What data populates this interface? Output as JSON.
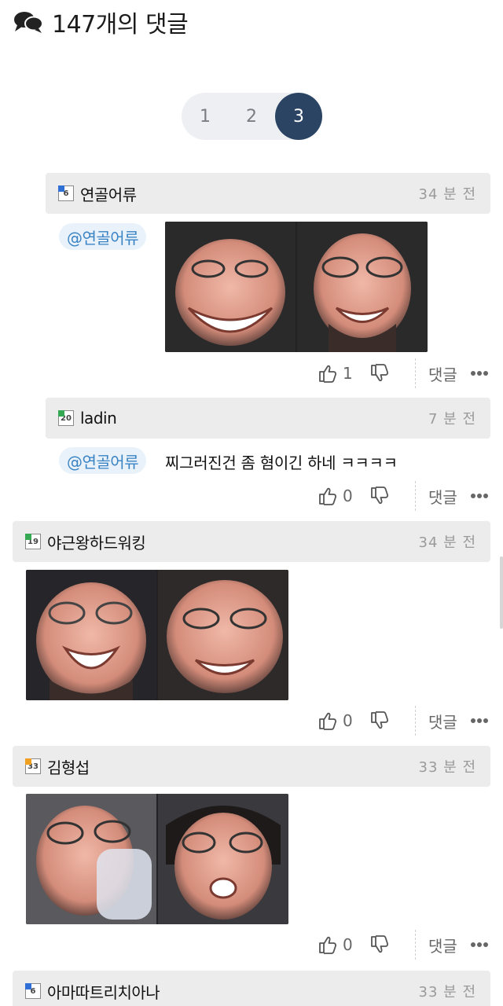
{
  "header": {
    "icon": "chat-bubbles-icon",
    "title": "147개의 댓글"
  },
  "pagination": {
    "pages": [
      "1",
      "2",
      "3"
    ],
    "current": "3"
  },
  "comments": [
    {
      "level_badge": "6",
      "username": "연골어류",
      "time": "34 분 전",
      "mention": "@연골어류",
      "text": "",
      "has_images": true,
      "likes": "1",
      "reply_label": "댓글"
    },
    {
      "level_badge": "20",
      "username": "ladin",
      "time": "7 분 전",
      "mention": "@연골어류",
      "text": "찌그러진건 좀 혐이긴 하네 ㅋㅋㅋㅋ",
      "has_images": false,
      "likes": "0",
      "reply_label": "댓글"
    },
    {
      "level_badge": "19",
      "username": "야근왕하드워킹",
      "time": "34 분 전",
      "mention": "",
      "text": "",
      "has_images": true,
      "likes": "0",
      "reply_label": "댓글"
    },
    {
      "level_badge": "33",
      "username": "김형섭",
      "time": "33 분 전",
      "mention": "",
      "text": "",
      "has_images": true,
      "likes": "0",
      "reply_label": "댓글"
    },
    {
      "level_badge": "6",
      "username": "아마따트리치아나",
      "time": "33 분 전",
      "mention": "",
      "text": "",
      "has_images": false,
      "likes": "",
      "reply_label": ""
    }
  ],
  "colors": {
    "accent": "#2c4463",
    "mention_text": "#3b84c4",
    "mention_bg": "#e9f2fa",
    "bar_bg": "#ececec"
  }
}
